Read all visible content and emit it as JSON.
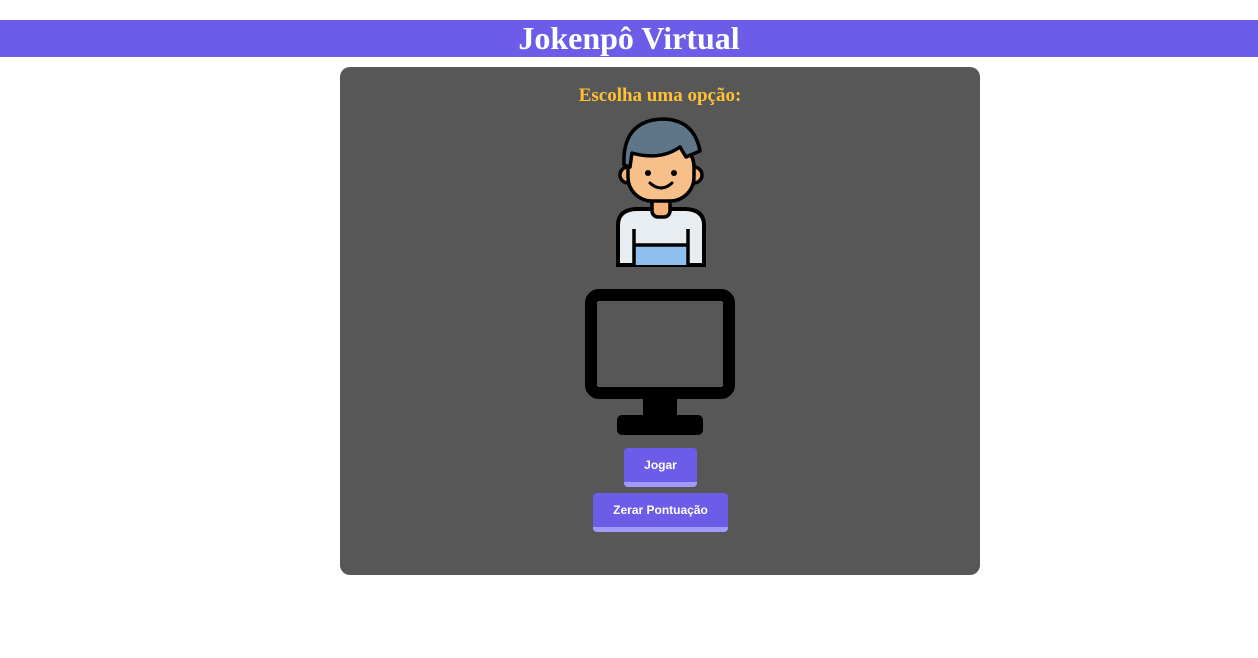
{
  "header": {
    "title": "Jokenpô Virtual"
  },
  "game": {
    "prompt": "Escolha uma opção:",
    "player_icon": "boy-avatar-icon",
    "computer_icon": "monitor-icon"
  },
  "buttons": {
    "play_label": "Jogar",
    "reset_label": "Zerar Pontuação"
  },
  "colors": {
    "accent": "#6c5ce7",
    "accent_light": "#a29bfe",
    "panel": "#575757",
    "prompt": "#ffc133",
    "text_on_accent": "#ffffff"
  }
}
